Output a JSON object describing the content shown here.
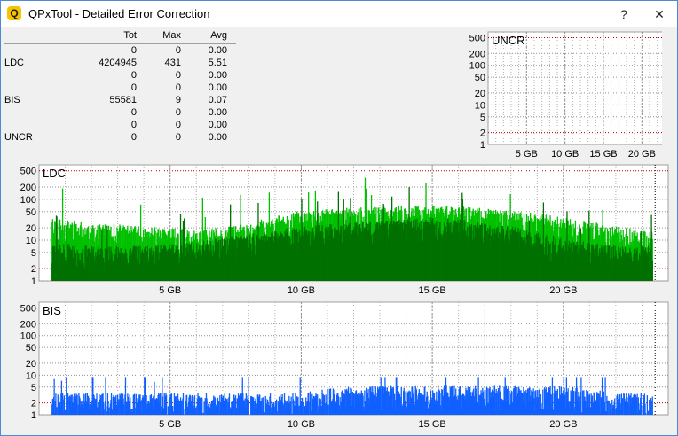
{
  "window": {
    "title": "QPxTool - Detailed Error Correction",
    "icon_letter": "Q",
    "help_label": "?",
    "close_label": "✕"
  },
  "stats": {
    "headers": [
      "Tot",
      "Max",
      "Avg"
    ],
    "rows": [
      {
        "label": "",
        "tot": "0",
        "max": "0",
        "avg": "0.00"
      },
      {
        "label": "LDC",
        "tot": "4204945",
        "max": "431",
        "avg": "5.51"
      },
      {
        "label": "",
        "tot": "0",
        "max": "0",
        "avg": "0.00"
      },
      {
        "label": "",
        "tot": "0",
        "max": "0",
        "avg": "0.00"
      },
      {
        "label": "BIS",
        "tot": "55581",
        "max": "9",
        "avg": "0.07"
      },
      {
        "label": "",
        "tot": "0",
        "max": "0",
        "avg": "0.00"
      },
      {
        "label": "",
        "tot": "0",
        "max": "0",
        "avg": "0.00"
      },
      {
        "label": "UNCR",
        "tot": "0",
        "max": "0",
        "avg": "0.00"
      }
    ]
  },
  "charts": {
    "uncr": {
      "label": "UNCR",
      "y_ticks": [
        "500",
        "200",
        "100",
        "50",
        "20",
        "10",
        "5",
        "2",
        "1"
      ],
      "x_ticks": [
        "5 GB",
        "10 GB",
        "15 GB",
        "20 GB"
      ]
    },
    "ldc": {
      "label": "LDC",
      "y_ticks": [
        "500",
        "200",
        "100",
        "50",
        "20",
        "10",
        "5",
        "2",
        "1"
      ],
      "x_ticks": [
        "5 GB",
        "10 GB",
        "15 GB",
        "20 GB"
      ]
    },
    "bis": {
      "label": "BIS",
      "y_ticks": [
        "500",
        "200",
        "100",
        "50",
        "20",
        "10",
        "5",
        "2",
        "1"
      ],
      "x_ticks": [
        "5 GB",
        "10 GB",
        "15 GB",
        "20 GB"
      ]
    }
  },
  "chart_data": [
    {
      "type": "bar",
      "title": "UNCR",
      "y_scale": "log",
      "ylim": [
        1,
        500
      ],
      "xlim": [
        0,
        24
      ],
      "x_unit": "GB",
      "series": [
        {
          "name": "UNCR",
          "values": []
        }
      ],
      "grid": true
    },
    {
      "type": "bar",
      "title": "LDC",
      "y_scale": "log",
      "ylim": [
        1,
        500
      ],
      "xlim": [
        0,
        24
      ],
      "x_unit": "GB",
      "x": [
        0.5,
        2,
        4,
        6,
        8,
        10,
        12,
        14,
        15,
        16,
        18,
        20,
        22,
        23.4
      ],
      "series": [
        {
          "values": [
            20,
            15,
            12,
            10,
            14,
            30,
            35,
            38,
            40,
            38,
            30,
            20,
            12,
            10
          ],
          "color": "#00c000"
        },
        {
          "values": [
            5,
            4,
            4,
            5,
            8,
            12,
            15,
            18,
            20,
            18,
            12,
            6,
            4,
            4
          ],
          "color": "#007000"
        }
      ],
      "max": 431,
      "grid": true
    },
    {
      "type": "bar",
      "title": "BIS",
      "y_scale": "log",
      "ylim": [
        1,
        500
      ],
      "xlim": [
        0,
        24
      ],
      "x_unit": "GB",
      "x": [
        0.5,
        2,
        4,
        6,
        8,
        10,
        12,
        14,
        15,
        16,
        18,
        20,
        22,
        23.4
      ],
      "series": [
        {
          "values": [
            2,
            2,
            2,
            2,
            2,
            2,
            3,
            3,
            3,
            3,
            3,
            3,
            2,
            2
          ],
          "color": "#1060ff"
        }
      ],
      "max": 9,
      "grid": true
    }
  ]
}
